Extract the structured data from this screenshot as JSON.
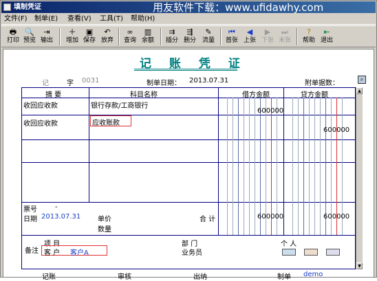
{
  "window": {
    "title": "填制凭证"
  },
  "watermark": "用友软件下载：www.ufidawhy.com",
  "menu": [
    "文件(F)",
    "制单(E)",
    "查看(V)",
    "工具(T)",
    "帮助(H)"
  ],
  "toolbar": [
    {
      "label": "打印",
      "icon": "printer-icon"
    },
    {
      "label": "预览",
      "icon": "preview-icon"
    },
    {
      "label": "输出",
      "icon": "export-icon"
    },
    {
      "label": "增加",
      "icon": "add-icon"
    },
    {
      "label": "保存",
      "icon": "save-icon"
    },
    {
      "label": "放弃",
      "icon": "undo-icon"
    },
    {
      "label": "查询",
      "icon": "binoculars-icon"
    },
    {
      "label": "余额",
      "icon": "balance-chart-icon"
    },
    {
      "label": "插分",
      "icon": "insert-row-icon"
    },
    {
      "label": "删分",
      "icon": "delete-row-icon"
    },
    {
      "label": "流量",
      "icon": "cashflow-icon"
    },
    {
      "label": "首张",
      "icon": "first-icon"
    },
    {
      "label": "上张",
      "icon": "prev-icon"
    },
    {
      "label": "下张",
      "icon": "next-icon"
    },
    {
      "label": "末张",
      "icon": "last-icon"
    },
    {
      "label": "帮助",
      "icon": "help-icon"
    },
    {
      "label": "退出",
      "icon": "exit-icon"
    }
  ],
  "voucher": {
    "title": "记 账 凭 证",
    "type_label": "记",
    "zi": "字",
    "number": "0031",
    "date_label": "制单日期：",
    "date": "2013.07.31",
    "attach_label": "附单据数：",
    "headers": {
      "summary": "摘 要",
      "account": "科目名称",
      "debit": "借方金额",
      "credit": "贷方金额"
    },
    "rows": [
      {
        "summary": "收回应收款",
        "account": "银行存款/工商银行",
        "debit": "600000",
        "credit": ""
      },
      {
        "summary": "收回应收款",
        "account": "应收账款",
        "debit": "",
        "credit": "600000"
      },
      {
        "summary": "",
        "account": "",
        "debit": "",
        "credit": ""
      },
      {
        "summary": "",
        "account": "",
        "debit": "",
        "credit": ""
      }
    ],
    "footer": {
      "piao_label": "票号",
      "piao_value": "-",
      "date_label": "日期",
      "date_value": "2013.07.31",
      "price_label": "单价",
      "qty_label": "数量",
      "total_label": "合 计",
      "total_debit": "600000",
      "total_credit": "600000",
      "remark_label": "备注",
      "project_label": "项 目",
      "customer_label": "客 户",
      "customer_value": "客户A",
      "dept_label": "部 门",
      "person_label": "个 人",
      "salesman_label": "业务员"
    },
    "bottom": {
      "keep_label": "记账",
      "audit_label": "审核",
      "cashier_label": "出纳",
      "maker_label": "制单",
      "maker_value": "demo"
    }
  },
  "colors": {
    "title": "#008080",
    "grid": "#000080",
    "red_line": "#e03030",
    "blue_text": "#1a3cc8"
  }
}
